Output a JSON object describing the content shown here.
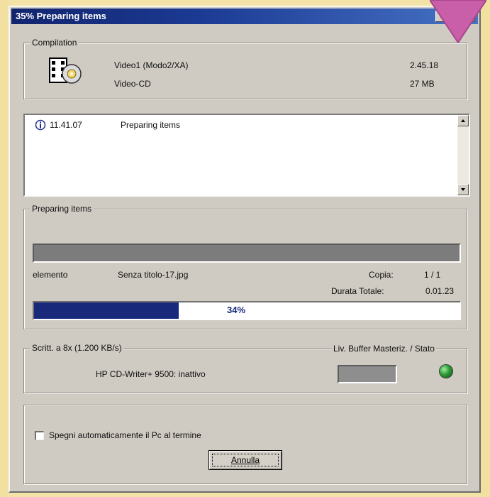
{
  "window": {
    "title": "35% Preparing items",
    "minimize_glyph": "_",
    "close_glyph": "✕"
  },
  "compilation": {
    "legend": "Compilation",
    "name": "Video1 (Modo2/XA)",
    "format": "Video-CD",
    "duration": "2.45.18",
    "size": "27 MB",
    "icon": "video-cd-icon"
  },
  "log": {
    "entries": [
      {
        "time": "11.41.07",
        "message": "Preparing items",
        "icon": "info-icon"
      }
    ]
  },
  "preparing": {
    "legend": "Preparing items",
    "item_label": "elemento",
    "item_value": "Senza titolo-17.jpg",
    "copy_label": "Copia:",
    "copy_value": "1 / 1",
    "total_label": "Durata Totale:",
    "total_value": "0.01.23",
    "progress_percent": 34,
    "progress_text": "34%",
    "progress_color": "#18297c"
  },
  "writer": {
    "legend": "Scritt. a 8x (1.200 KB/s)",
    "status_label": "Liv. Buffer Masteriz. / Stato",
    "device": "HP CD-Writer+ 9500: inattivo",
    "led_color": "#2e9a36"
  },
  "footer": {
    "checkbox_label": "Spegni automaticamente il Pc al termine",
    "checkbox_checked": false,
    "cancel_label": "Annulla"
  }
}
